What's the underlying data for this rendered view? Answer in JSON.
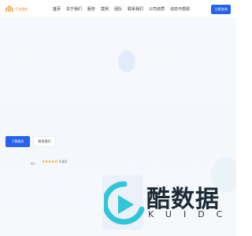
{
  "header": {
    "logo_text": "千金建筑",
    "nav": [
      "首页",
      "关于我们",
      "服务",
      "案例",
      "团队",
      "联系我们",
      "公司资质",
      "动态与帮助"
    ],
    "consult_label": "立即咨询"
  },
  "hero": {
    "primary_label": "了解服务",
    "secondary_label": "联系我们"
  },
  "rating": {
    "small_label": "客户",
    "stars": "★★★★★",
    "value": "4.8/5",
    "score": 4.8,
    "max": 5
  },
  "watermark": {
    "cn": "酷数据",
    "en": "KUIDC"
  },
  "colors": {
    "accent": "#2563eb",
    "logo": "#f08a1c",
    "star": "#f5a524",
    "watermark_teal": "#2ec6d8"
  },
  "icons": [
    "logo-icon",
    "star-icon",
    "watermark-play-icon"
  ]
}
